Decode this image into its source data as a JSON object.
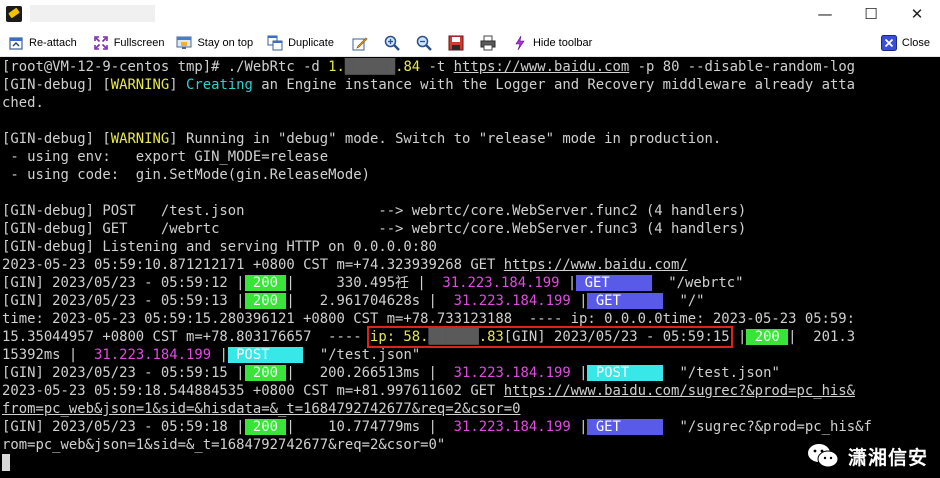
{
  "window": {
    "minimize_glyph": "—",
    "maximize_glyph": "☐",
    "close_glyph": "✕"
  },
  "toolbar": {
    "reattach": "Re-attach",
    "fullscreen": "Fullscreen",
    "stay_on_top": "Stay on top",
    "duplicate": "Duplicate",
    "hide_toolbar": "Hide toolbar",
    "close": "Close",
    "icons": [
      "reattach-icon",
      "fullscreen-icon",
      "stay-on-top-icon",
      "duplicate-icon",
      "edit-icon",
      "zoom-in-icon",
      "zoom-out-icon",
      "save-icon",
      "print-icon",
      "hide-toolbar-icon",
      "close-icon"
    ]
  },
  "terminal": {
    "colors": {
      "background": "#000000",
      "text": "#d0d0d0",
      "warning": "#e8e84a",
      "info": "#2ed0d0",
      "ip": "#e24ae2",
      "status_ok": "#37e437",
      "method_get": "#5a5ae8",
      "method_post": "#38e8e8",
      "highlight_box": "#e02020"
    },
    "lines": [
      [
        {
          "t": "[root@VM-12-9-centos tmp]# ./WebRtc -d ",
          "c": "w"
        },
        {
          "t": "1.",
          "c": "y"
        },
        {
          "t": "██████",
          "c": "redact"
        },
        {
          "t": ".84",
          "c": "y"
        },
        {
          "t": " -t ",
          "c": "w"
        },
        {
          "t": "https://www.baidu.com",
          "c": "u"
        },
        {
          "t": " -p 80 --disable-random-log",
          "c": "w"
        }
      ],
      [
        {
          "t": "[GIN-debug] [",
          "c": "w"
        },
        {
          "t": "WARNING",
          "c": "y"
        },
        {
          "t": "] ",
          "c": "w"
        },
        {
          "t": "Creating",
          "c": "c"
        },
        {
          "t": " an Engine instance with the Logger and Recovery middleware already atta",
          "c": "w"
        }
      ],
      [
        {
          "t": "ched.",
          "c": "w"
        }
      ],
      [
        {
          "t": "",
          "c": "w"
        }
      ],
      [
        {
          "t": "[GIN-debug] [",
          "c": "w"
        },
        {
          "t": "WARNING",
          "c": "y"
        },
        {
          "t": "] Running in \"debug\" mode. Switch to \"release\" mode in production.",
          "c": "w"
        }
      ],
      [
        {
          "t": " - using env:   export GIN_MODE=release",
          "c": "w"
        }
      ],
      [
        {
          "t": " - using code:  gin.SetMode(gin.ReleaseMode)",
          "c": "w"
        }
      ],
      [
        {
          "t": "",
          "c": "w"
        }
      ],
      [
        {
          "t": "[GIN-debug] POST   /test.json                --> webrtc/core.WebServer.func2 (4 handlers)",
          "c": "w"
        }
      ],
      [
        {
          "t": "[GIN-debug] GET    /webrtc                   --> webrtc/core.WebServer.func3 (4 handlers)",
          "c": "w"
        }
      ],
      [
        {
          "t": "[GIN-debug] Listening and serving HTTP on 0.0.0.0:80",
          "c": "w"
        }
      ],
      [
        {
          "t": "2023-05-23 05:59:10.871212171 +0800 CST m=+74.323939268 GET ",
          "c": "w"
        },
        {
          "t": "https://www.baidu.com/",
          "c": "u"
        }
      ],
      [
        {
          "t": "[GIN] 2023/05/23 - 05:59:12 |",
          "c": "w"
        },
        {
          "t": " 200 ",
          "c": "bg-green"
        },
        {
          "t": "|     330.495祍 |  ",
          "c": "w"
        },
        {
          "t": "31.223.184.199",
          "c": "m"
        },
        {
          "t": " |",
          "c": "w"
        },
        {
          "t": " GET     ",
          "c": "bg-blue"
        },
        {
          "t": "  \"/webrtc\"",
          "c": "w"
        }
      ],
      [
        {
          "t": "[GIN] 2023/05/23 - 05:59:13 |",
          "c": "w"
        },
        {
          "t": " 200 ",
          "c": "bg-green"
        },
        {
          "t": "|   2.961704628s |  ",
          "c": "w"
        },
        {
          "t": "31.223.184.199",
          "c": "m"
        },
        {
          "t": " |",
          "c": "w"
        },
        {
          "t": " GET     ",
          "c": "bg-blue"
        },
        {
          "t": "  \"/\"",
          "c": "w"
        }
      ],
      [
        {
          "t": "time: 2023-05-23 05:59:15.280396121 +0800 CST m=+78.733123188  ---- ip: 0.0.0.0time: 2023-05-23 05:59:",
          "c": "w"
        }
      ],
      [
        {
          "t": "15.35044957 +0800 CST m=+78.803176657  ---- ",
          "c": "w"
        },
        {
          "t": "ip: 58.",
          "c": "y",
          "box": true
        },
        {
          "t": "██████",
          "c": "redact",
          "box": true
        },
        {
          "t": ".83",
          "c": "y",
          "box": true
        },
        {
          "t": "[GIN] 2023/05/23 - 05:59:15",
          "c": "w",
          "box": true
        },
        {
          "t": " |",
          "c": "w"
        },
        {
          "t": " 200 ",
          "c": "bg-green"
        },
        {
          "t": "|  201.3",
          "c": "w"
        }
      ],
      [
        {
          "t": "15392ms |  ",
          "c": "w"
        },
        {
          "t": "31.223.184.199",
          "c": "m"
        },
        {
          "t": " |",
          "c": "w"
        },
        {
          "t": " POST    ",
          "c": "bg-cyan"
        },
        {
          "t": "  \"/test.json\"",
          "c": "w"
        }
      ],
      [
        {
          "t": "[GIN] 2023/05/23 - 05:59:15 |",
          "c": "w"
        },
        {
          "t": " 200 ",
          "c": "bg-green"
        },
        {
          "t": "|   200.266513ms |  ",
          "c": "w"
        },
        {
          "t": "31.223.184.199",
          "c": "m"
        },
        {
          "t": " |",
          "c": "w"
        },
        {
          "t": " POST    ",
          "c": "bg-cyan"
        },
        {
          "t": "  \"/test.json\"",
          "c": "w"
        }
      ],
      [
        {
          "t": "2023-05-23 05:59:18.544884535 +0800 CST m=+81.997611602 GET ",
          "c": "w"
        },
        {
          "t": "https://www.baidu.com/sugrec?&prod=pc_his&",
          "c": "u"
        }
      ],
      [
        {
          "t": "from=pc_web&json=1&sid=&hisdata=&_t=1684792742677&req=2&csor=0",
          "c": "u"
        }
      ],
      [
        {
          "t": "[GIN] 2023/05/23 - 05:59:18 |",
          "c": "w"
        },
        {
          "t": " 200 ",
          "c": "bg-green"
        },
        {
          "t": "|    10.774779ms |  ",
          "c": "w"
        },
        {
          "t": "31.223.184.199",
          "c": "m"
        },
        {
          "t": " |",
          "c": "w"
        },
        {
          "t": " GET     ",
          "c": "bg-blue"
        },
        {
          "t": "  \"/sugrec?&prod=pc_his&f",
          "c": "w"
        }
      ],
      [
        {
          "t": "rom=pc_web&json=1&sid=&_t=1684792742677&req=2&csor=0\"",
          "c": "w"
        }
      ]
    ]
  },
  "watermark": {
    "text": "潇湘信安",
    "icon": "wechat-icon"
  }
}
